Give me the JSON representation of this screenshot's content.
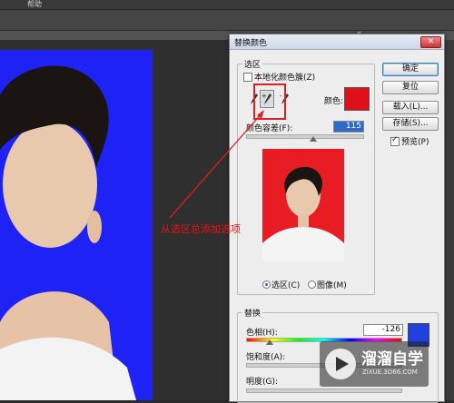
{
  "menubar": {
    "items": [
      "",
      "帮助"
    ]
  },
  "dialog": {
    "title": "替换颜色",
    "close_symbol": "✕",
    "selection_group": "选区",
    "localized_label": "本地化颜色簇(Z)",
    "color_label": "颜色:",
    "fuzziness_label": "颜色容差(F):",
    "fuzziness_value": "115",
    "radio_selection": "选区(C)",
    "radio_image": "图像(M)",
    "replacement_group": "替换",
    "hue_label": "色相(H):",
    "hue_value": "-126",
    "saturation_label": "饱和度(A):",
    "lightness_label": "明度(G):",
    "buttons": {
      "ok": "确定",
      "reset": "复位",
      "load": "载入(L)...",
      "save": "存储(S)..."
    },
    "preview_label": "预览(P)",
    "preview_checked": true,
    "selection_color": "#e0101a",
    "replacement_color": "#2040e0"
  },
  "annotation": {
    "text": "从选区总添加选项"
  },
  "watermark": {
    "title": "溜溜自学",
    "url": "ZIXUE.3D66.COM"
  }
}
